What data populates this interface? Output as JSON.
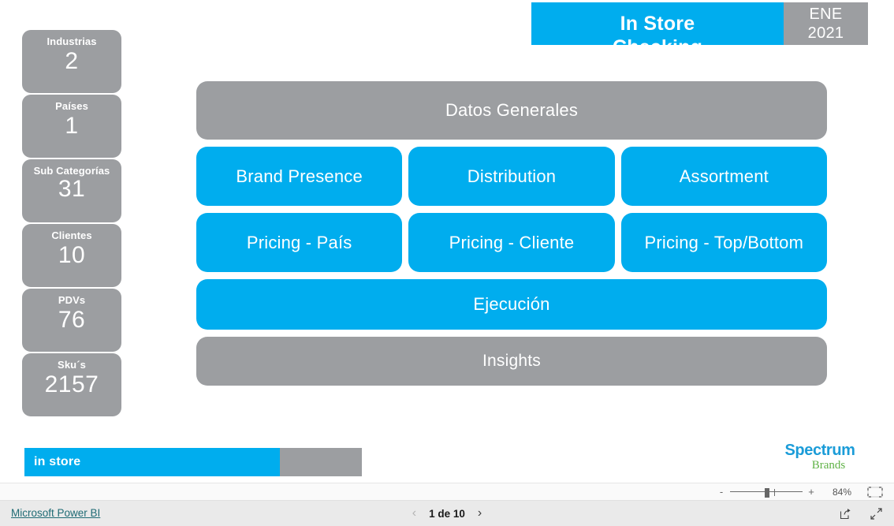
{
  "report": {
    "header": {
      "title_line1": "In Store",
      "title_line2": "Checking",
      "date_month": "ENE",
      "date_year": "2021",
      "accent_blue": "#00ADEE",
      "accent_grey": "#9C9EA1"
    },
    "kpi_cards": [
      {
        "label": "Industrias",
        "value": "2"
      },
      {
        "label": "Países",
        "value": "1"
      },
      {
        "label": "Sub Categorías",
        "value": "31"
      },
      {
        "label": "Clientes",
        "value": "10"
      },
      {
        "label": "PDVs",
        "value": "76"
      },
      {
        "label": "Sku´s",
        "value": "2157"
      }
    ],
    "nav_buttons": {
      "datos_generales": "Datos Generales",
      "brand_presence": "Brand Presence",
      "distribution": "Distribution",
      "assortment": "Assortment",
      "pricing_pais": "Pricing - País",
      "pricing_cliente": "Pricing - Cliente",
      "pricing_topbottom": "Pricing - Top/Bottom",
      "ejecucion": "Ejecución",
      "insights": "Insights"
    },
    "footer": {
      "instore_badge": "in store",
      "logo_primary": "Spectrum",
      "logo_secondary": "Brands",
      "logo_primary_color": "#1B9CD8",
      "logo_secondary_color": "#5FB246"
    }
  },
  "chrome": {
    "zoom": {
      "minus": "-",
      "plus": "+",
      "percent": "84%",
      "fit_icon": "fit-to-page-icon"
    },
    "status": {
      "brand_link": "Microsoft Power BI",
      "prev_icon": "chevron-left-icon",
      "next_icon": "chevron-right-icon",
      "page_label": "1 de 10",
      "share_icon": "share-icon",
      "fullscreen_icon": "fullscreen-icon"
    }
  }
}
